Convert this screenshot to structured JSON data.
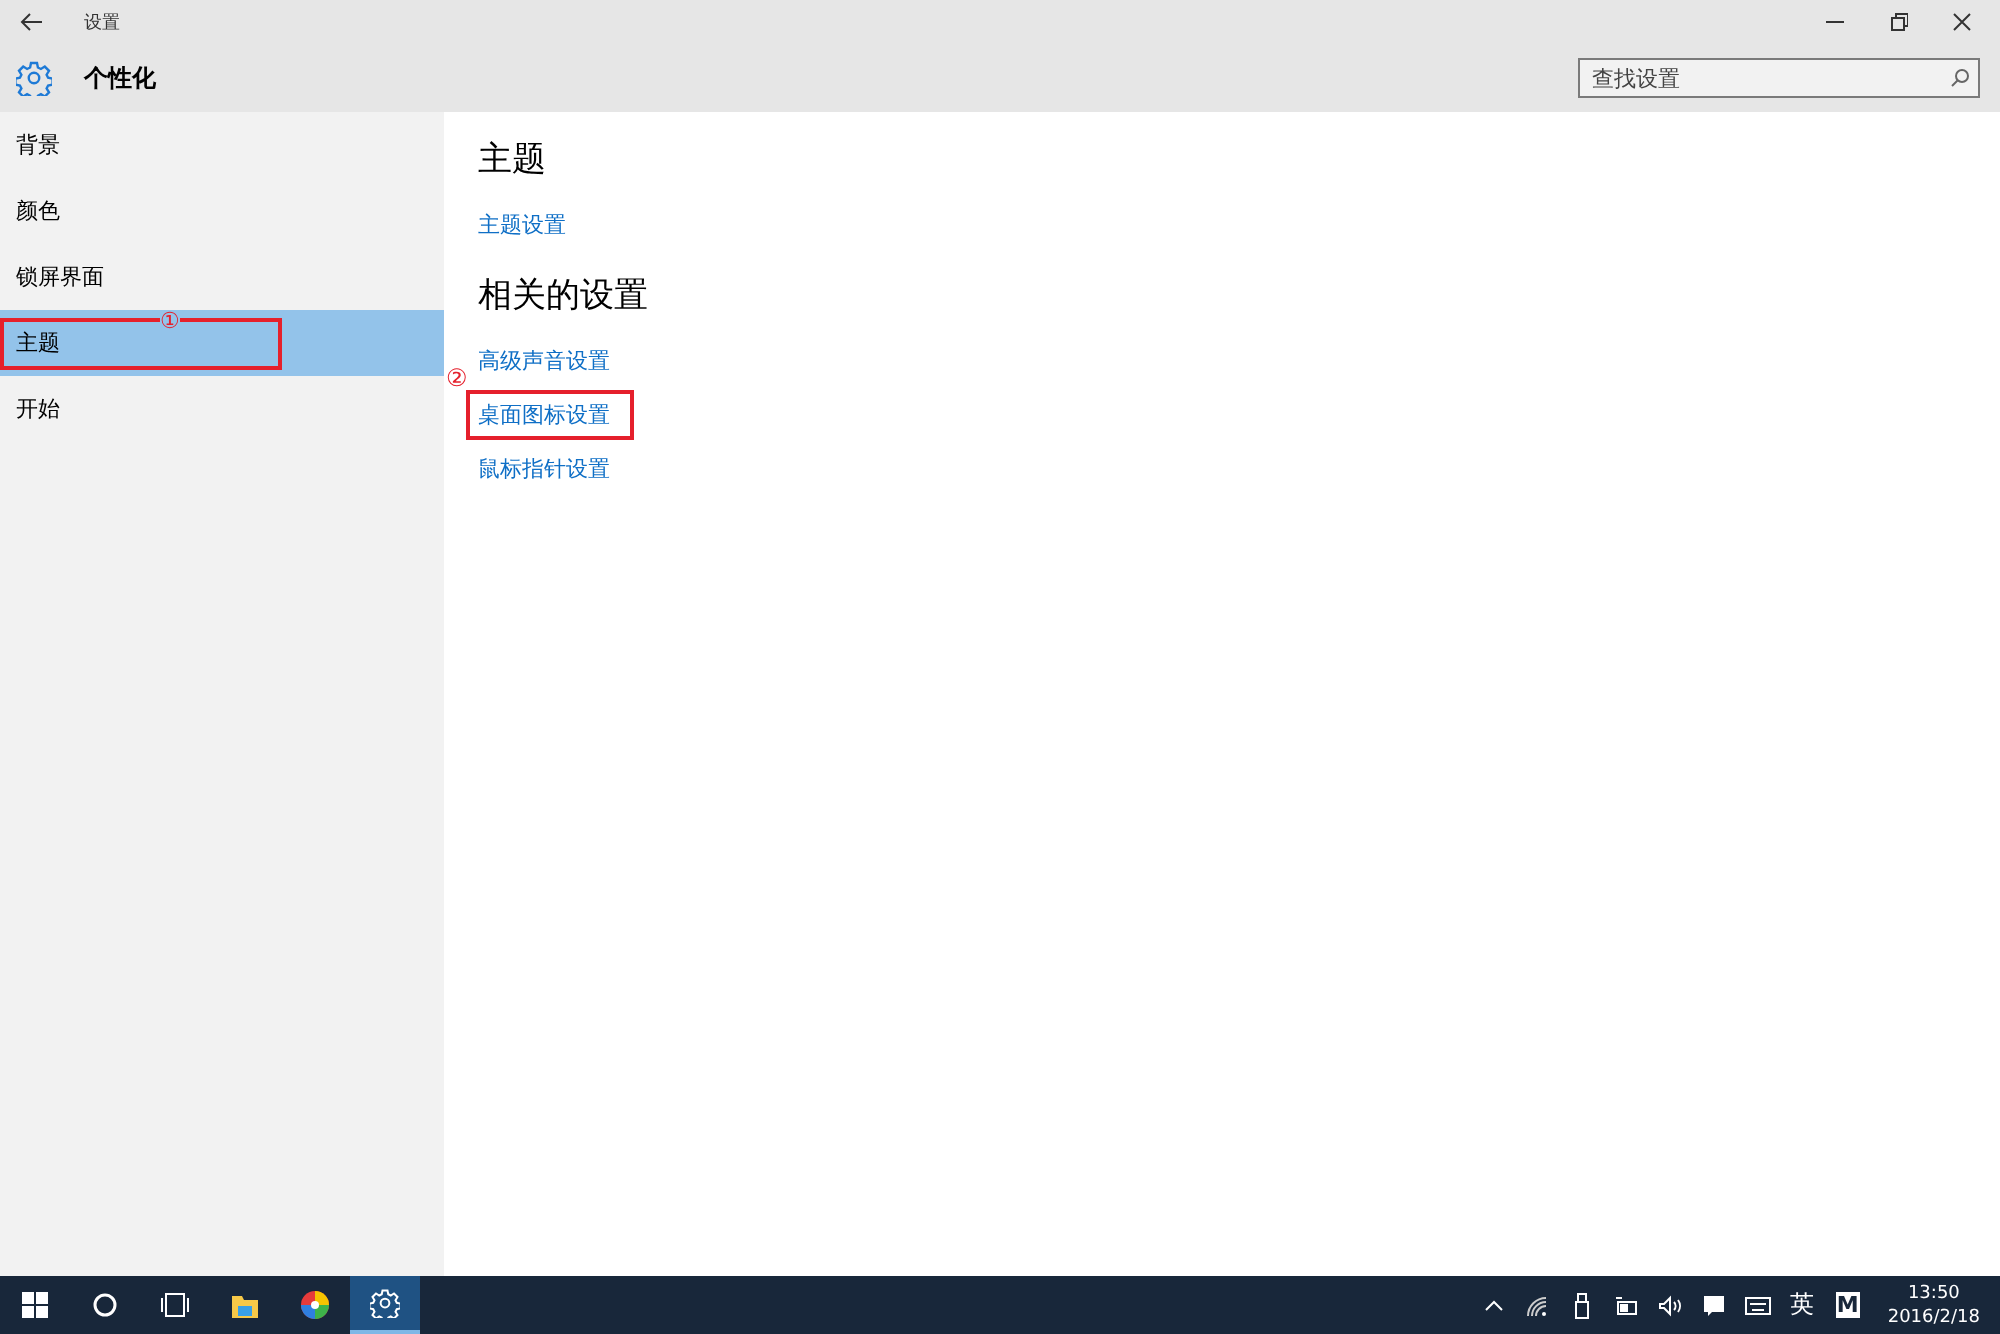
{
  "window": {
    "title": "设置",
    "controls": [
      {
        "kind": "minimize"
      },
      {
        "kind": "restore"
      },
      {
        "kind": "close"
      }
    ]
  },
  "header": {
    "title": "个性化",
    "search": {
      "placeholder": "查找设置"
    }
  },
  "sidebar": {
    "items": [
      {
        "label": "背景",
        "selected": false
      },
      {
        "label": "颜色",
        "selected": false
      },
      {
        "label": "锁屏界面",
        "selected": false
      },
      {
        "label": "主题",
        "selected": true,
        "annotation": "①"
      },
      {
        "label": "开始",
        "selected": false
      }
    ]
  },
  "content": {
    "sections": [
      {
        "heading": "主题",
        "links": [
          {
            "label": "主题设置"
          }
        ]
      },
      {
        "heading": "相关的设置",
        "links": [
          {
            "label": "高级声音设置"
          },
          {
            "label": "桌面图标设置",
            "annotation": "②"
          },
          {
            "label": "鼠标指针设置"
          }
        ]
      }
    ]
  },
  "taskbar": {
    "apps": [
      {
        "kind": "start",
        "selected": false
      },
      {
        "kind": "search",
        "selected": false
      },
      {
        "kind": "taskview",
        "selected": false
      },
      {
        "kind": "explorer",
        "selected": false
      },
      {
        "kind": "colorwheel",
        "selected": false
      },
      {
        "kind": "settings",
        "selected": true
      }
    ],
    "tray": [
      {
        "kind": "chevron"
      },
      {
        "kind": "wifi"
      },
      {
        "kind": "usb"
      },
      {
        "kind": "battery"
      },
      {
        "kind": "volume"
      },
      {
        "kind": "notification"
      },
      {
        "kind": "keyboard"
      }
    ],
    "ime": "英",
    "ime_mode": "M",
    "time": "13:50",
    "date": "2016/2/18"
  }
}
